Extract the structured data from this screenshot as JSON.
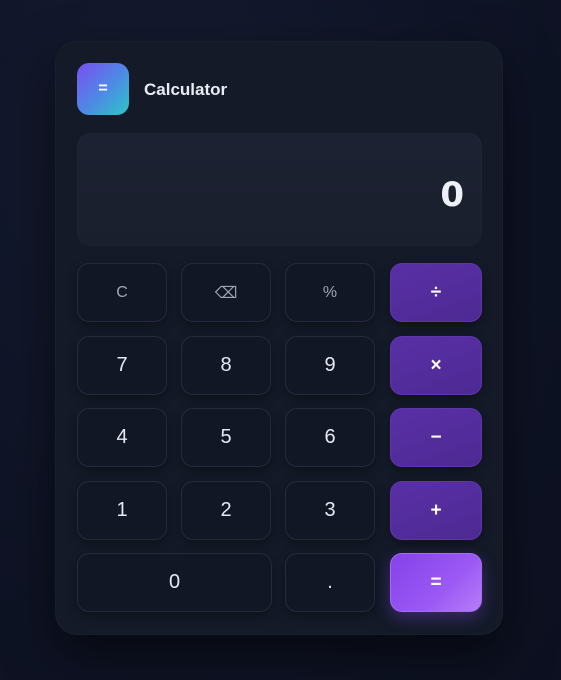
{
  "app": {
    "title": "Calculator",
    "logo_symbol": "="
  },
  "display": {
    "value": "0"
  },
  "keys": {
    "clear": "C",
    "backspace": "⌫",
    "percent": "%",
    "divide": "÷",
    "seven": "7",
    "eight": "8",
    "nine": "9",
    "multiply": "×",
    "four": "4",
    "five": "5",
    "six": "6",
    "subtract": "−",
    "one": "1",
    "two": "2",
    "three": "3",
    "add": "+",
    "zero": "0",
    "decimal": ".",
    "equals": "="
  },
  "colors": {
    "background": "#0f1426",
    "card": "#141a28",
    "display": "#1d2232",
    "key": "#121725",
    "operator": "#5a2fa6",
    "equals": "#9b58f4",
    "logo_gradient_start": "#7b4ff0",
    "logo_gradient_end": "#2cc6c4"
  }
}
